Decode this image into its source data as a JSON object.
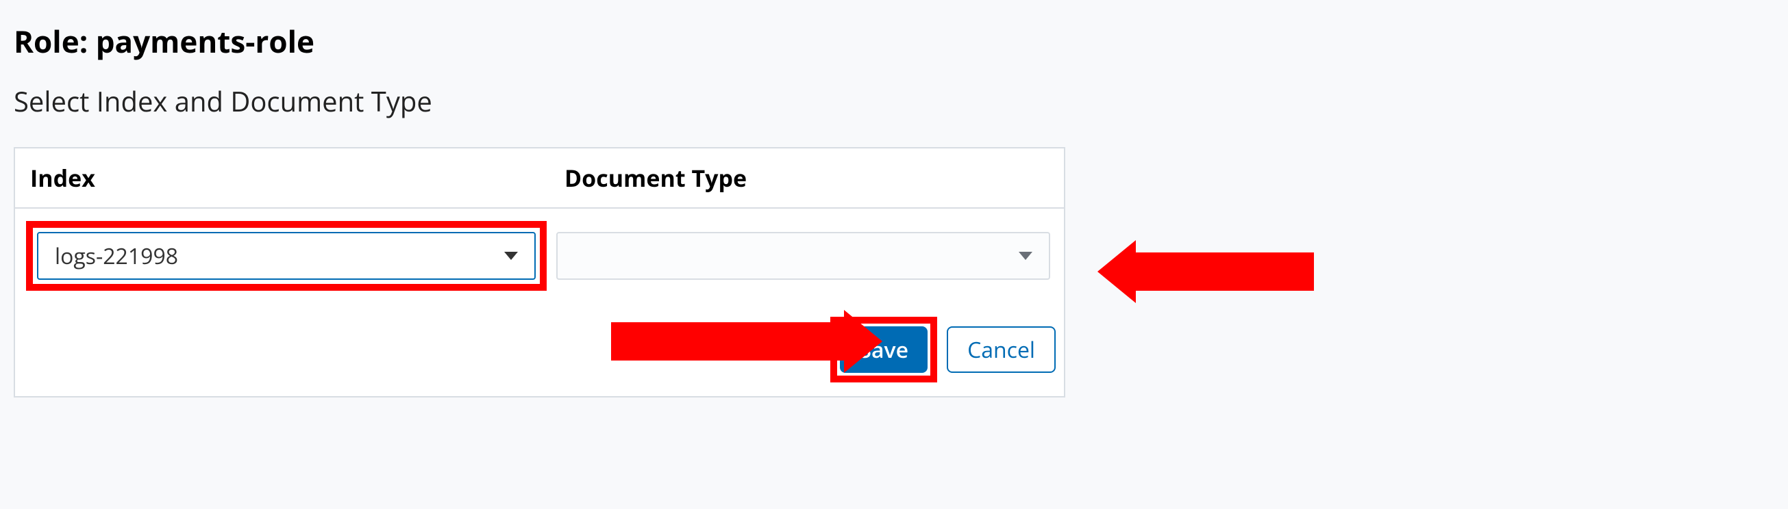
{
  "header": {
    "role_prefix": "Role: ",
    "role_name": "payments-role",
    "subheading": "Select Index and Document Type"
  },
  "columns": {
    "index": "Index",
    "doctype": "Document Type"
  },
  "form": {
    "index_value": "logs-221998",
    "doctype_value": ""
  },
  "buttons": {
    "save": "Save",
    "cancel": "Cancel"
  }
}
